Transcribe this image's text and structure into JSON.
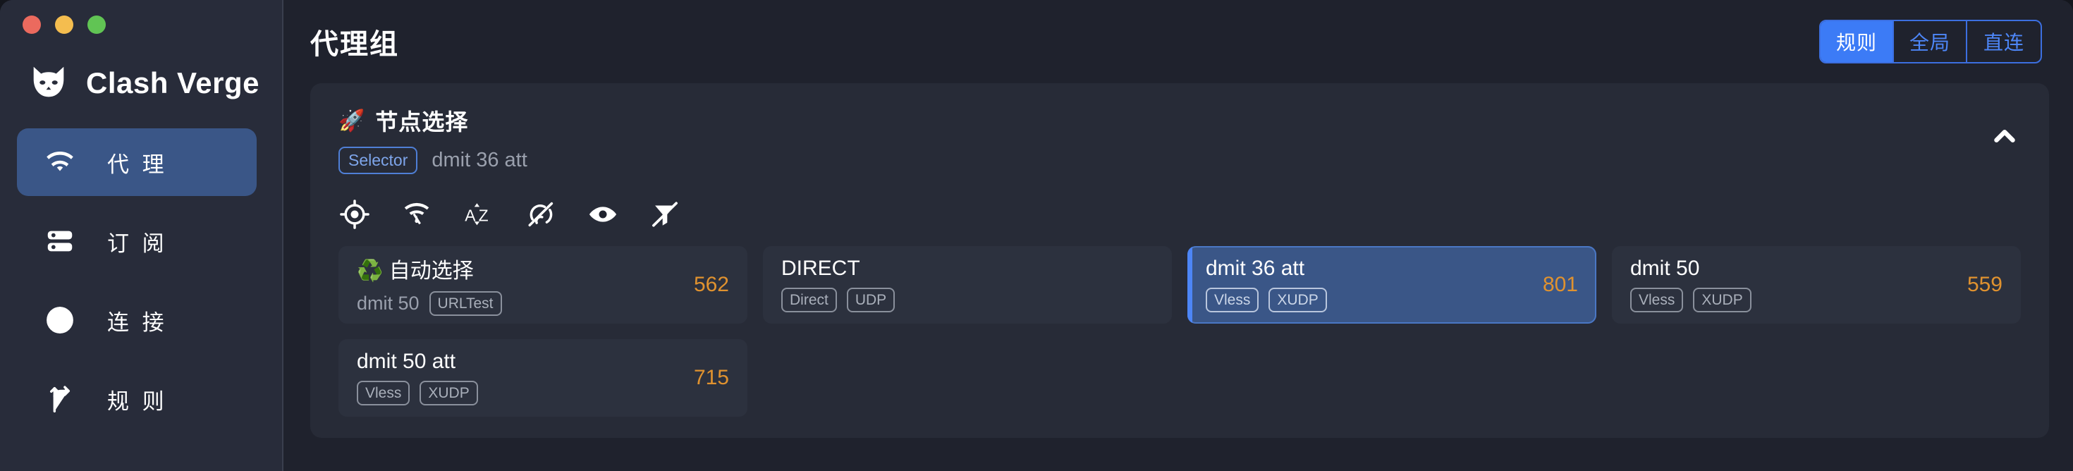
{
  "window": {
    "traffic_lights": [
      "close",
      "minimize",
      "maximize"
    ],
    "colors": {
      "close": "#eb6a5e",
      "minimize": "#f4bd4f",
      "maximize": "#61c454",
      "accent": "#3c7bf6",
      "selected_card": "#3a5687",
      "delay_text": "#e0922f"
    }
  },
  "brand": {
    "title": "Clash Verge",
    "logo_icon": "cat-logo-icon"
  },
  "sidebar": {
    "items": [
      {
        "label": "代 理",
        "icon": "wifi-icon",
        "active": true
      },
      {
        "label": "订 阅",
        "icon": "server-icon",
        "active": false
      },
      {
        "label": "连 接",
        "icon": "globe-icon",
        "active": false
      },
      {
        "label": "规 则",
        "icon": "rules-fork-icon",
        "active": false
      }
    ]
  },
  "header": {
    "title": "代理组",
    "modes": [
      {
        "label": "规则",
        "active": true
      },
      {
        "label": "全局",
        "active": false
      },
      {
        "label": "直连",
        "active": false
      }
    ]
  },
  "group": {
    "emoji": "🚀",
    "name": "节点选择",
    "type_badge": "Selector",
    "current": "dmit 36 att",
    "collapse_icon": "chevron-up-icon",
    "toolbar": [
      {
        "icon": "location-target-icon",
        "name": "locate-current"
      },
      {
        "icon": "speed-test-icon",
        "name": "delay-check"
      },
      {
        "icon": "sort-az-icon",
        "name": "sort-order"
      },
      {
        "icon": "signal-off-icon",
        "name": "hide-unavailable"
      },
      {
        "icon": "eye-icon",
        "name": "toggle-visibility"
      },
      {
        "icon": "filter-off-icon",
        "name": "clear-filter"
      }
    ],
    "proxies": [
      {
        "emoji": "♻️",
        "name": "自动选择",
        "sub": "dmit 50",
        "badges": [
          "URLTest"
        ],
        "delay": "562",
        "selected": false
      },
      {
        "emoji": "",
        "name": "DIRECT",
        "sub": "",
        "badges": [
          "Direct",
          "UDP"
        ],
        "delay": "",
        "selected": false
      },
      {
        "emoji": "",
        "name": "dmit 36 att",
        "sub": "",
        "badges": [
          "Vless",
          "XUDP"
        ],
        "delay": "801",
        "selected": true
      },
      {
        "emoji": "",
        "name": "dmit 50",
        "sub": "",
        "badges": [
          "Vless",
          "XUDP"
        ],
        "delay": "559",
        "selected": false
      },
      {
        "emoji": "",
        "name": "dmit 50 att",
        "sub": "",
        "badges": [
          "Vless",
          "XUDP"
        ],
        "delay": "715",
        "selected": false
      }
    ]
  }
}
